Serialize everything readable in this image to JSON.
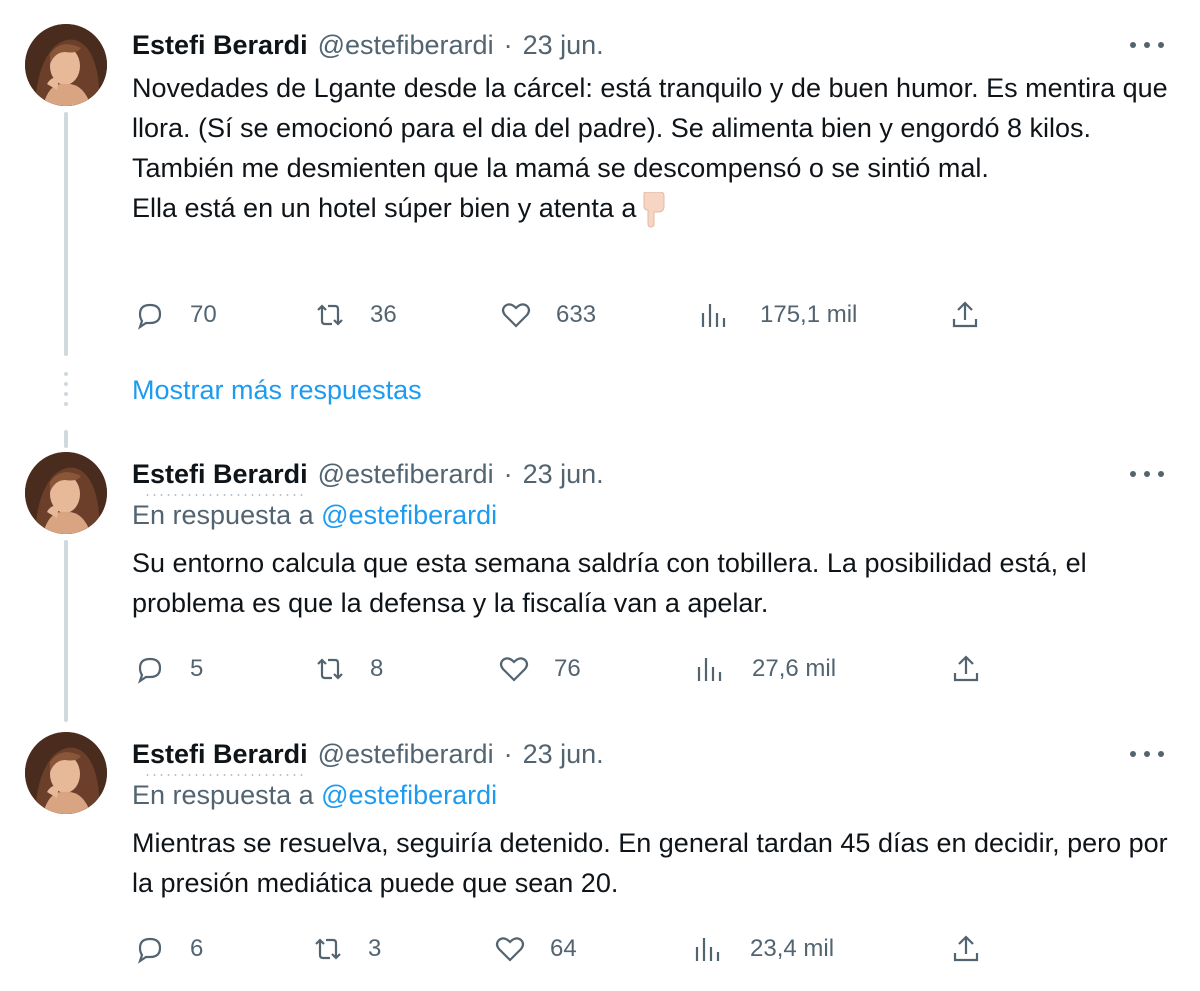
{
  "tweets": [
    {
      "name": "Estefi Berardi",
      "handle": "@estefiberardi",
      "separator": "·",
      "date": "23 jun.",
      "reply_prefix": "",
      "reply_handle": "",
      "paragraphs": [
        "Novedades de Lgante desde la cárcel: está tranquilo y de buen humor. Es mentira que llora. (Sí se emocionó para el dia del padre). Se alimenta bien y engordó 8 kilos.",
        "También me desmienten que la mamá se descompensó o se sintió mal.",
        "Ella está en un hotel súper bien y atenta a"
      ],
      "trailing_emoji": "backhand-index-pointing-down",
      "replies": "70",
      "retweets": "36",
      "likes": "633",
      "views": "175,1 mil"
    },
    {
      "name": "Estefi Berardi",
      "handle": "@estefiberardi",
      "separator": "·",
      "date": "23 jun.",
      "reply_prefix": "En respuesta a",
      "reply_handle": "@estefiberardi",
      "paragraphs": [
        "Su entorno calcula que esta semana saldría con tobillera. La posibilidad está, el problema es que la defensa y la fiscalía van a apelar."
      ],
      "replies": "5",
      "retweets": "8",
      "likes": "76",
      "views": "27,6 mil"
    },
    {
      "name": "Estefi Berardi",
      "handle": "@estefiberardi",
      "separator": "·",
      "date": "23 jun.",
      "reply_prefix": "En respuesta a",
      "reply_handle": "@estefiberardi",
      "paragraphs": [
        "Mientras se resuelva, seguiría detenido. En general tardan 45 días en decidir, pero por la presión mediática puede que sean 20."
      ],
      "replies": "6",
      "retweets": "3",
      "likes": "64",
      "views": "23,4 mil"
    }
  ],
  "show_more_label": "Mostrar más respuestas",
  "icons": {
    "reply": "reply-icon",
    "retweet": "retweet-icon",
    "like": "heart-icon",
    "views": "views-icon",
    "share": "share-icon",
    "more": "more-icon"
  },
  "colors": {
    "text": "#0f1419",
    "muted": "#536471",
    "link": "#1d9bf0",
    "thread_line": "#cfd9de"
  }
}
